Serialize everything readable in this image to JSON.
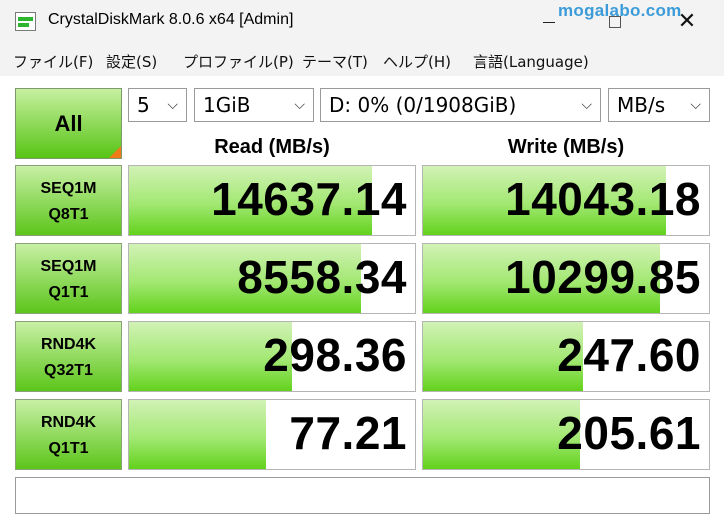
{
  "window": {
    "title": "CrystalDiskMark 8.0.6 x64 [Admin]",
    "watermark": "mogalabo.com",
    "close_glyph": "✕"
  },
  "menu": [
    {
      "label": "ファイル(F)"
    },
    {
      "label": "設定(S)"
    },
    {
      "label": "プロファイル(P)"
    },
    {
      "label": "テーマ(T)"
    },
    {
      "label": "ヘルプ(H)"
    },
    {
      "label": "言語(Language)"
    }
  ],
  "controls": {
    "all_label": "All",
    "count": "5",
    "size": "1GiB",
    "drive": "D: 0% (0/1908GiB)",
    "unit": "MB/s",
    "arrow": "⌵"
  },
  "columns": {
    "read": "Read (MB/s)",
    "write": "Write (MB/s)"
  },
  "rows": [
    {
      "line1": "SEQ1M",
      "line2": "Q8T1",
      "read": "14637.14",
      "write": "14043.18",
      "read_fill": 0.85,
      "write_fill": 0.85
    },
    {
      "line1": "SEQ1M",
      "line2": "Q1T1",
      "read": "8558.34",
      "write": "10299.85",
      "read_fill": 0.81,
      "write_fill": 0.83
    },
    {
      "line1": "RND4K",
      "line2": "Q32T1",
      "read": "298.36",
      "write": "247.60",
      "read_fill": 0.57,
      "write_fill": 0.56
    },
    {
      "line1": "RND4K",
      "line2": "Q1T1",
      "read": "77.21",
      "write": "205.61",
      "read_fill": 0.48,
      "write_fill": 0.55
    }
  ],
  "comment": ""
}
